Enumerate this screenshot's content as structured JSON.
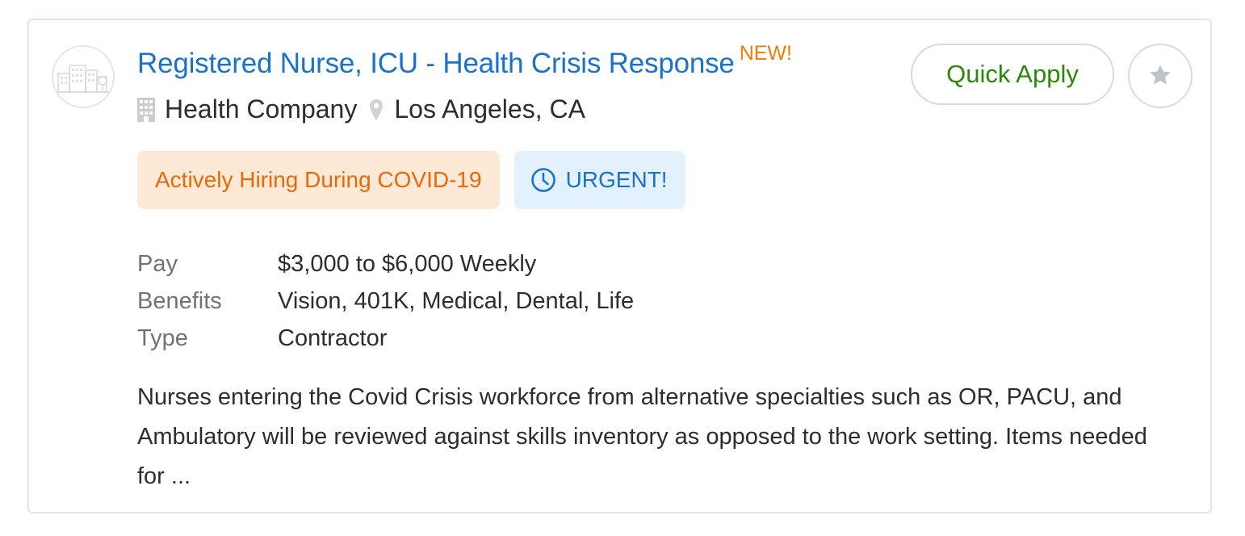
{
  "job": {
    "title": "Registered Nurse, ICU - Health Crisis Response",
    "new_badge": "NEW!",
    "company": "Health Company",
    "location": "Los Angeles, CA",
    "tags": [
      {
        "label": "Actively Hiring During COVID-19",
        "color": "#e8690a",
        "bg": "#fee9d7"
      },
      {
        "label": "URGENT!",
        "color": "#1a73c9",
        "bg": "#e3f1fd",
        "icon": "clock-icon"
      }
    ],
    "details": [
      {
        "label": "Pay",
        "value": "$3,000 to $6,000 Weekly"
      },
      {
        "label": "Benefits",
        "value": "Vision, 401K, Medical, Dental, Life"
      },
      {
        "label": "Type",
        "value": "Contractor"
      }
    ],
    "description": "Nurses entering the Covid Crisis workforce from alternative specialties such as OR, PACU, and Ambulatory will be reviewed against skills inventory as opposed to the work setting. Items needed for ..."
  },
  "actions": {
    "quick_apply_label": "Quick Apply",
    "save_icon": "star-icon"
  },
  "icons": {
    "logo": "company-logo-icon",
    "company": "building-icon",
    "location": "map-pin-icon"
  },
  "colors": {
    "link": "#1a73c9",
    "new": "#f47a0b",
    "apply": "#2a8a08"
  }
}
